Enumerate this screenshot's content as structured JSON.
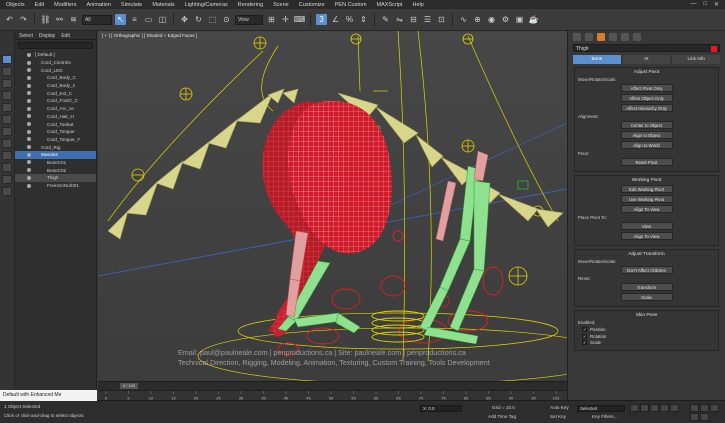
{
  "menubar": {
    "items": [
      "Objects",
      "Edit",
      "Modifiers",
      "Animation",
      "Simulate",
      "Materials",
      "Lighting/Cameras",
      "Rendering",
      "Scene",
      "Customize",
      "PEN Custom",
      "MAXScript",
      "Help"
    ],
    "window_controls": [
      "—",
      "□",
      "✕"
    ]
  },
  "toolbar": {
    "selection_filter": "All",
    "view_dropdown": "View"
  },
  "scene_explorer": {
    "tabs": [
      "Select",
      "Display",
      "Edit"
    ],
    "tree": [
      {
        "label": "[ Default ]",
        "indent": 0
      },
      {
        "label": "Cord_Controls",
        "indent": 1
      },
      {
        "label": "Cord_LEG",
        "indent": 1
      },
      {
        "label": "Cord_Body_C",
        "indent": 2
      },
      {
        "label": "Cord_Body_2",
        "indent": 2
      },
      {
        "label": "Cord_Ext_C",
        "indent": 2
      },
      {
        "label": "Cord_FootC_C",
        "indent": 2
      },
      {
        "label": "Cord_Arc_nn",
        "indent": 2
      },
      {
        "label": "Cord_Hair_H",
        "indent": 2
      },
      {
        "label": "Cord_Toebat",
        "indent": 2
      },
      {
        "label": "Cord_Tongue",
        "indent": 2
      },
      {
        "label": "Cord_Tongue_Y",
        "indent": 2
      },
      {
        "label": "Cord_Rig",
        "indent": 1
      },
      {
        "label": "Muscles",
        "indent": 1,
        "state": "selected"
      },
      {
        "label": "BoneC01",
        "indent": 2
      },
      {
        "label": "BoneC02",
        "indent": 2
      },
      {
        "label": "Thigh",
        "indent": 2,
        "state": "highlight"
      },
      {
        "label": "FreeGmNurb01",
        "indent": 2
      }
    ]
  },
  "viewport": {
    "label": "[ + ] [ Orthographic ] [ Shaded + Edged Faces ]",
    "watermark_line1": "Email: paul@paulneale.com | penproductions.ca | Site: paulneale.com | penproductions.ca",
    "watermark_line2": "Technical Direction, Rigging, Modeling, Animation, Texturing, Custom Training, Tools Development"
  },
  "timeline": {
    "frame": "0 / 100",
    "ticks": [
      "0",
      "5",
      "10",
      "15",
      "20",
      "25",
      "30",
      "35",
      "40",
      "45",
      "50",
      "55",
      "60",
      "65",
      "70",
      "75",
      "80",
      "85",
      "90",
      "95",
      "100"
    ]
  },
  "command_panel": {
    "object_name": "Thigh",
    "subtabs": [
      "Bone",
      "IK",
      "Link Info"
    ],
    "adjust_pivot": {
      "title": "Adjust Pivot",
      "move_label": "Move/Rotate/Scale:",
      "buttons": [
        "Affect Pivot Only",
        "Affect Object Only",
        "Affect Hierarchy Only"
      ],
      "alignment_label": "Alignment:",
      "align_buttons": [
        "Center to Object",
        "Align to Object",
        "Align to World"
      ],
      "pivot_label": "Pivot:",
      "reset_button": "Reset Pivot"
    },
    "working_pivot": {
      "title": "Working Pivot",
      "buttons": [
        "Edit Working Pivot",
        "Use Working Pivot",
        "Align To View"
      ],
      "place_label": "Place Pivot To:",
      "view_button": "View",
      "align_view_button": "Align To View"
    },
    "adjust_transform": {
      "title": "Adjust Transform",
      "move_label": "Move/Rotate/Scale:",
      "buttons": [
        "Don't Affect Children"
      ],
      "reset_label": "Reset:",
      "reset_buttons": [
        "Transform",
        "Scale"
      ]
    },
    "skin_pose": {
      "title": "Skin Pose",
      "enabled_label": "Enabled:",
      "checks": [
        {
          "label": "Position",
          "checked": true
        },
        {
          "label": "Rotation",
          "checked": true
        },
        {
          "label": "Scale",
          "checked": true
        }
      ]
    }
  },
  "status": {
    "left_label": "Default with Enhanced Me",
    "line1": "1 Object Selected",
    "line2": "Click or click-and-drag to select objects",
    "coord_x": "X: 0.0",
    "grid": "Grid = 10.0",
    "auto_key": "Auto Key",
    "set_key": "Set Key",
    "selected": "Selected",
    "key_filters": "Key Filters...",
    "add_time_tag": "Add Time Tag"
  },
  "colors": {
    "viewport_bg": "#404040",
    "accent_blue": "#5b8fcf",
    "mesh_red": "#d11a2a",
    "bone_yellow": "#d8d68a",
    "bone_green": "#8fe08f",
    "rig_yellow": "#e0d400",
    "rig_red": "#e02020"
  }
}
